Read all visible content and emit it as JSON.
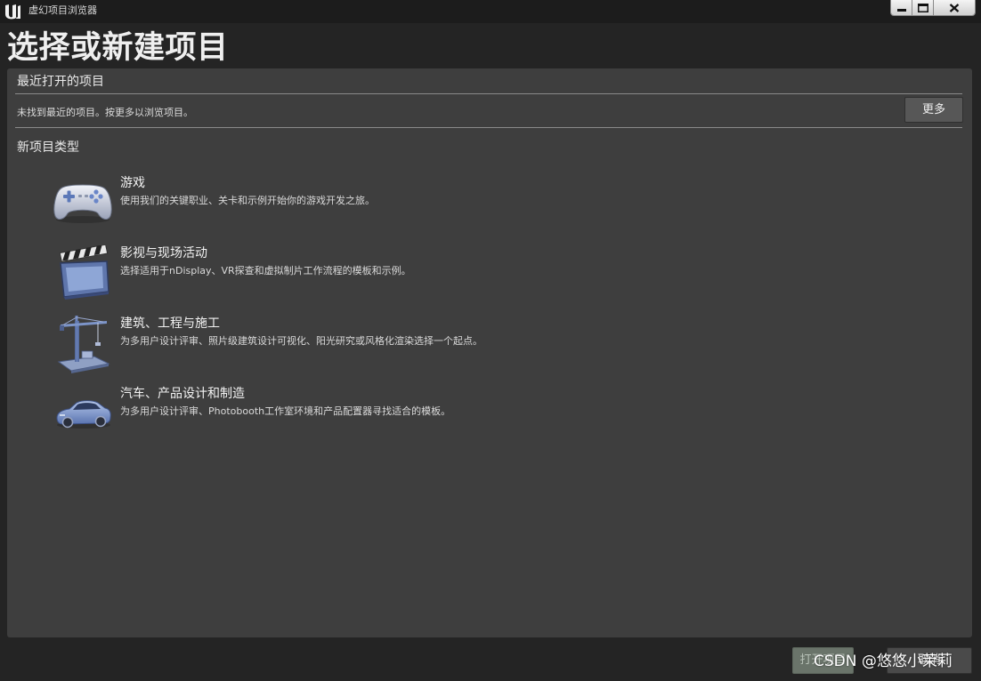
{
  "window": {
    "title": "虚幻项目浏览器",
    "controls": [
      "minimize-icon",
      "maximize-icon",
      "close-icon"
    ]
  },
  "page_title": "选择或新建项目",
  "recent": {
    "header": "最近打开的项目",
    "empty_message": "未找到最近的项目。按更多以浏览项目。",
    "more_button_label": "更多"
  },
  "new_project": {
    "header": "新项目类型",
    "categories": [
      {
        "icon": "gamepad-icon",
        "title": "游戏",
        "description": "使用我们的关键职业、关卡和示例开始你的游戏开发之旅。"
      },
      {
        "icon": "clapperboard-icon",
        "title": "影视与现场活动",
        "description": "选择适用于nDisplay、VR探查和虚拟制片工作流程的模板和示例。"
      },
      {
        "icon": "crane-icon",
        "title": "建筑、工程与施工",
        "description": "为多用户设计评审、照片级建筑设计可视化、阳光研究或风格化渲染选择一个起点。"
      },
      {
        "icon": "car-icon",
        "title": "汽车、产品设计和制造",
        "description": "为多用户设计评审、Photobooth工作室环境和产品配置器寻找适合的模板。"
      }
    ]
  },
  "footer": {
    "open_button_label": "打开项目",
    "cancel_button_label": "取消"
  },
  "watermark": "CSDN @悠悠小茉莉"
}
